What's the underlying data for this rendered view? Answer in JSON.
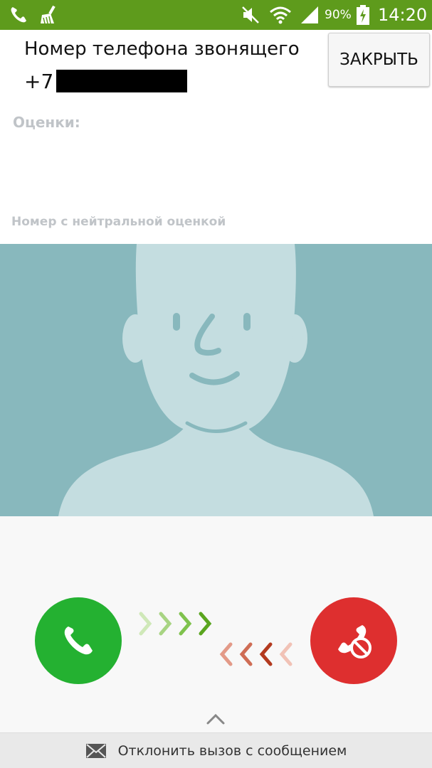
{
  "status_bar": {
    "icons": [
      "phone-icon",
      "cleaner-icon",
      "mute-icon",
      "wifi-icon",
      "signal-icon",
      "battery-charging-icon"
    ],
    "battery": "90%",
    "time": "14:20",
    "colors": {
      "background": "#5e9b1c",
      "foreground": "#ffffff"
    }
  },
  "caller": {
    "title": "Номер телефона звонящего",
    "number_prefix": "+7",
    "close_label": "ЗАКРЫТЬ",
    "ratings_label": "Оценки:",
    "rating_status": "Номер с нейтральной оценкой"
  },
  "photo": {
    "icon": "contact-silhouette-icon",
    "colors": {
      "background": "#88b8bd",
      "silhouette": "#c4dde0",
      "features": "#88b8bd"
    }
  },
  "controls": {
    "accept_icon": "phone-answer-icon",
    "reject_icon": "phone-reject-icon",
    "colors": {
      "accept": "#24b131",
      "reject": "#de2f2f",
      "background": "#f8f8f8"
    },
    "swipe_hint_icon": "chevron-up-icon"
  },
  "bottom_bar": {
    "icon": "envelope-icon",
    "label": "Отклонить вызов с сообщением"
  }
}
